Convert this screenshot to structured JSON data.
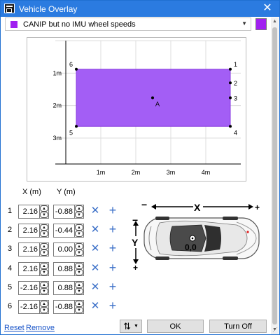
{
  "window": {
    "title": "Vehicle Overlay",
    "close_glyph": "✕"
  },
  "layer": {
    "selected": "CANIP but no IMU wheel speeds",
    "color": "#a020f0"
  },
  "chart_data": {
    "type": "scatter",
    "x_ticks": [
      "1m",
      "2m",
      "3m",
      "4m"
    ],
    "y_ticks": [
      "1m",
      "2m",
      "3m"
    ],
    "polygon": [
      {
        "label": "1",
        "x": 4.7,
        "y": 0.88
      },
      {
        "label": "2",
        "x": 4.7,
        "y": 1.3
      },
      {
        "label": "3",
        "x": 4.7,
        "y": 1.76
      },
      {
        "label": "4",
        "x": 4.7,
        "y": 2.64
      },
      {
        "label": "5",
        "x": 0.3,
        "y": 2.64
      },
      {
        "label": "6",
        "x": 0.3,
        "y": 0.88
      }
    ],
    "anchor": {
      "label": "A",
      "x": 2.48,
      "y": 1.76
    },
    "xlim": [
      -0.3,
      5.0
    ],
    "ylim": [
      0,
      3.8
    ],
    "grid": true,
    "fill_color": "#a35ef5"
  },
  "table": {
    "x_header": "X (m)",
    "y_header": "Y (m)",
    "rows": [
      {
        "index": "1",
        "x": "2.16",
        "y": "-0.88"
      },
      {
        "index": "2",
        "x": "2.16",
        "y": "-0.44"
      },
      {
        "index": "3",
        "x": "2.16",
        "y": "0.00"
      },
      {
        "index": "4",
        "x": "2.16",
        "y": "0.88"
      },
      {
        "index": "5",
        "x": "-2.16",
        "y": "0.88"
      },
      {
        "index": "6",
        "x": "-2.16",
        "y": "-0.88"
      }
    ],
    "delete_glyph": "✕",
    "add_glyph": "+"
  },
  "diagram": {
    "x_label": "X",
    "y_label": "Y",
    "minus": "−",
    "plus": "+",
    "origin": "0,0"
  },
  "footer": {
    "reset": "Reset",
    "remove": "Remove",
    "sort_glyph": "⇅",
    "ok": "OK",
    "turn_off": "Turn Off"
  }
}
